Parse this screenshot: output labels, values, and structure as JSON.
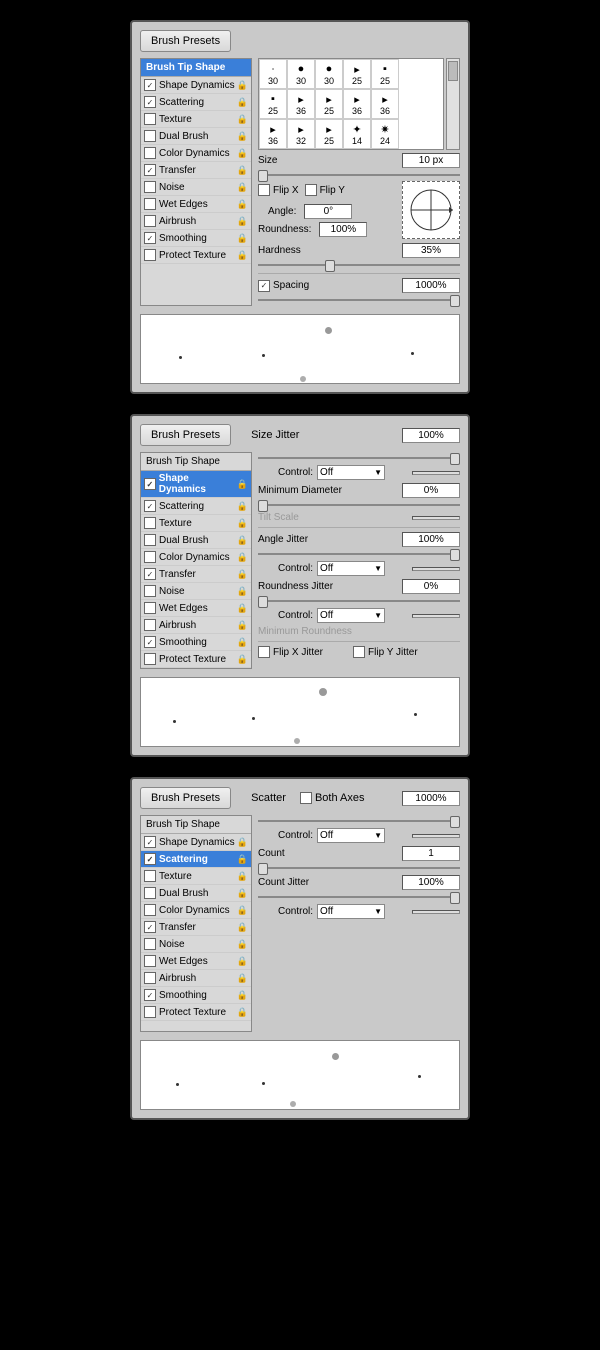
{
  "brushPresets": "Brush Presets",
  "opts": {
    "tip": "Brush Tip Shape",
    "sd": "Shape Dynamics",
    "sc": "Scattering",
    "tx": "Texture",
    "db": "Dual Brush",
    "cd": "Color Dynamics",
    "tr": "Transfer",
    "no": "Noise",
    "we": "Wet Edges",
    "ab": "Airbrush",
    "sm": "Smoothing",
    "pt": "Protect Texture"
  },
  "check": "✓",
  "grid": [
    [
      "30",
      "30",
      "30",
      "25",
      "25"
    ],
    [
      "25",
      "36",
      "25",
      "36",
      "36"
    ],
    [
      "36",
      "32",
      "25",
      "14",
      "24"
    ]
  ],
  "p1": {
    "size": "Size",
    "sizeVal": "10 px",
    "flipX": "Flip X",
    "flipY": "Flip Y",
    "angle": "Angle:",
    "angleVal": "0°",
    "round": "Roundness:",
    "roundVal": "100%",
    "hard": "Hardness",
    "hardVal": "35%",
    "spacing": "Spacing",
    "spacingVal": "1000%"
  },
  "p2": {
    "sj": "Size Jitter",
    "sjVal": "100%",
    "ctrl": "Control:",
    "off": "Off",
    "md": "Minimum Diameter",
    "mdVal": "0%",
    "ts": "Tilt Scale",
    "aj": "Angle Jitter",
    "ajVal": "100%",
    "rj": "Roundness Jitter",
    "rjVal": "0%",
    "mr": "Minimum Roundness",
    "fxj": "Flip X Jitter",
    "fyj": "Flip Y Jitter"
  },
  "p3": {
    "scatter": "Scatter",
    "ba": "Both Axes",
    "scVal": "1000%",
    "count": "Count",
    "countVal": "1",
    "cj": "Count Jitter",
    "cjVal": "100%"
  }
}
